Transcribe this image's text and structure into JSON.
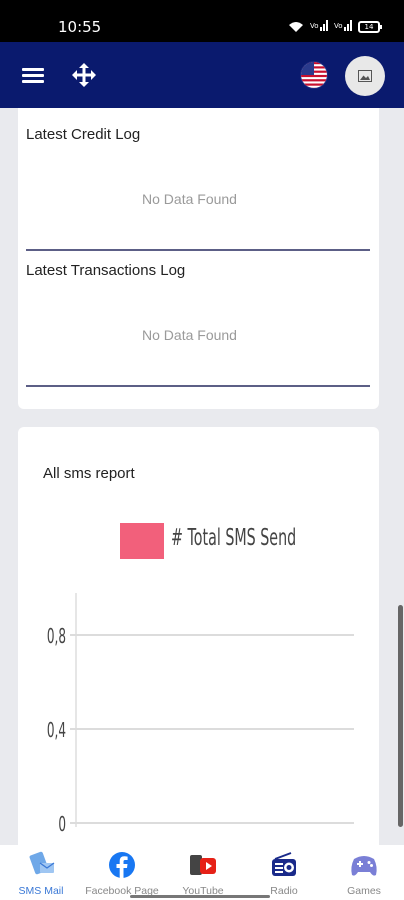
{
  "status_bar": {
    "time": "10:55",
    "signal_text_1": "Vo",
    "signal_text_2": "Vo",
    "battery": "14"
  },
  "app_bar": {
    "background_color": "#0a1a6e",
    "menu_icon": "hamburger-icon",
    "move_icon": "move-arrows-icon",
    "language_flag": "us-flag-icon",
    "avatar_icon": "image-placeholder-icon"
  },
  "credit_log": {
    "title": "Latest Credit Log",
    "empty_text": "No Data Found"
  },
  "transactions_log": {
    "title": "Latest Transactions Log",
    "empty_text": "No Data Found"
  },
  "sms_report": {
    "title": "All sms report"
  },
  "chart_data": {
    "type": "bar",
    "title": "",
    "series": [
      {
        "name": "# Total SMS Send",
        "color": "#f2607b",
        "values": []
      }
    ],
    "categories": [],
    "y_ticks": [
      "0",
      "0,4",
      "0,8"
    ],
    "ylim": [
      0,
      1
    ],
    "grid": true,
    "legend_position": "top"
  },
  "bottom_nav": {
    "items": [
      {
        "label": "SMS Mail",
        "icon": "sms-mail-icon",
        "active": true
      },
      {
        "label": "Facebook Page",
        "icon": "facebook-icon",
        "active": false
      },
      {
        "label": "YouTube",
        "icon": "youtube-icon",
        "active": false
      },
      {
        "label": "Radio",
        "icon": "radio-icon",
        "active": false
      },
      {
        "label": "Games",
        "icon": "gamepad-icon",
        "active": false
      }
    ],
    "active_color": "#3a78d6"
  }
}
